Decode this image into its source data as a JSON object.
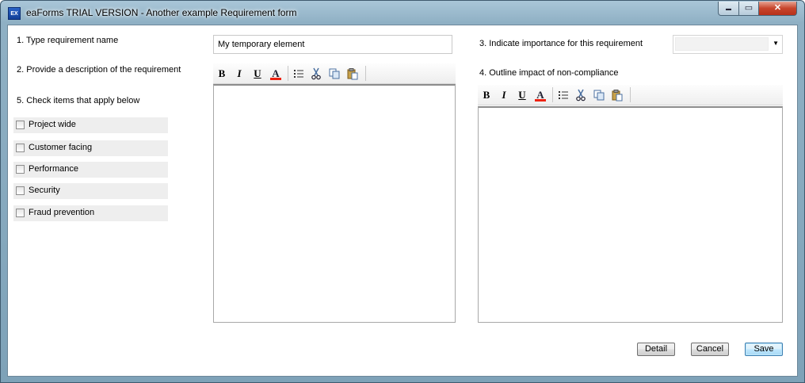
{
  "window": {
    "icon_text": "EX",
    "title": "eaForms TRIAL VERSION - Another example Requirement form",
    "controls": {
      "minimize": "▬",
      "maximize": "▭",
      "close": "✕"
    }
  },
  "form": {
    "field1": {
      "label": "1. Type requirement name",
      "value": "My temporary element",
      "placeholder": ""
    },
    "field2": {
      "label": "2. Provide a description of the requirement"
    },
    "field3": {
      "label": "3. Indicate importance for this requirement",
      "selected": ""
    },
    "field4": {
      "label": "4. Outline impact of non-compliance"
    },
    "field5": {
      "label": "5. Check items that apply below",
      "items": [
        {
          "label": "Project wide",
          "checked": false
        },
        {
          "label": "Customer facing",
          "checked": false
        },
        {
          "label": "Performance",
          "checked": false
        },
        {
          "label": "Security",
          "checked": false
        },
        {
          "label": "Fraud prevention",
          "checked": false
        }
      ]
    }
  },
  "toolbar": {
    "bold": "B",
    "italic": "I",
    "underline": "U",
    "font_color": "A",
    "icons": [
      "bold-icon",
      "italic-icon",
      "underline-icon",
      "font-color-icon",
      "bullet-list-icon",
      "cut-icon",
      "copy-icon",
      "paste-icon"
    ]
  },
  "buttons": {
    "detail": "Detail",
    "cancel": "Cancel",
    "save": "Save"
  },
  "colors": {
    "accent": "#3c7fb1",
    "font_color_bar": "#e21",
    "close_button": "#c7452c"
  }
}
